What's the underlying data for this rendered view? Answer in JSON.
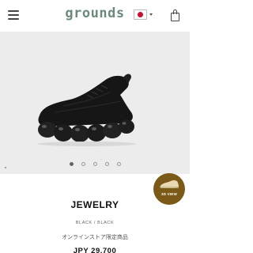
{
  "header": {
    "logo": "grounds",
    "language_flag": "japan-flag-icon"
  },
  "gallery": {
    "image": "black-sneaker-jewelry",
    "view_3d_label": "3D VIEW",
    "slide_count": 5,
    "active_slide": 1
  },
  "product": {
    "name": "JEWELRY",
    "color": "BLACK / BLACK",
    "limited_note": "オンラインストア限定商品",
    "price": "JPY 29,700"
  },
  "colors": {
    "logo": "#6b8a7a",
    "view_3d_badge": "#7a5a16",
    "gallery_bg": "#ececec"
  }
}
